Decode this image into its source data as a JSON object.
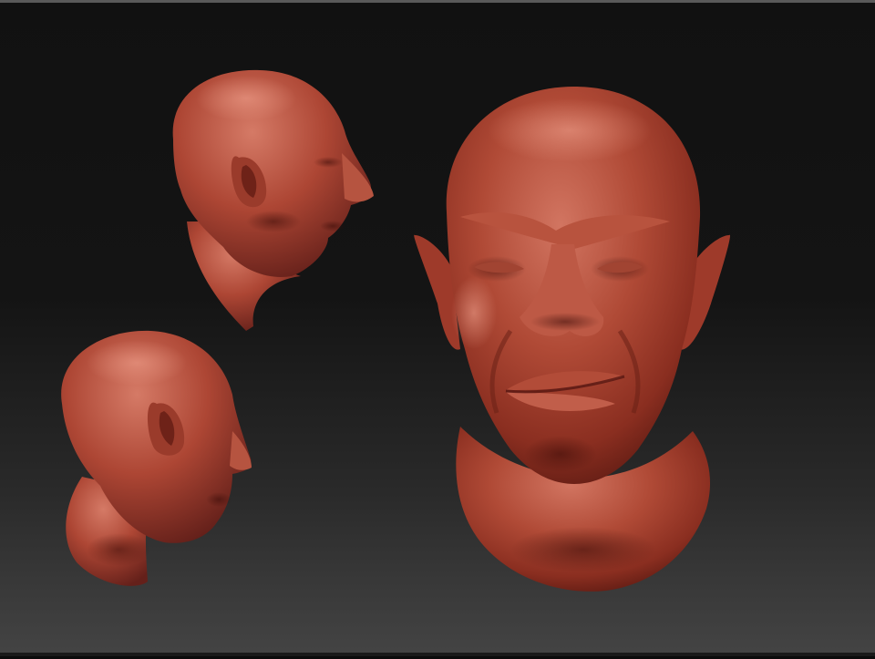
{
  "scene": {
    "description_colors": {
      "background_top": "#111111",
      "background_bottom": "#444444",
      "clay_base": "#a53d2c",
      "clay_light": "#cf6a55",
      "clay_shadow": "#5a1a12"
    },
    "views": [
      "front-view",
      "side-view-top",
      "side-view-bottom"
    ]
  }
}
